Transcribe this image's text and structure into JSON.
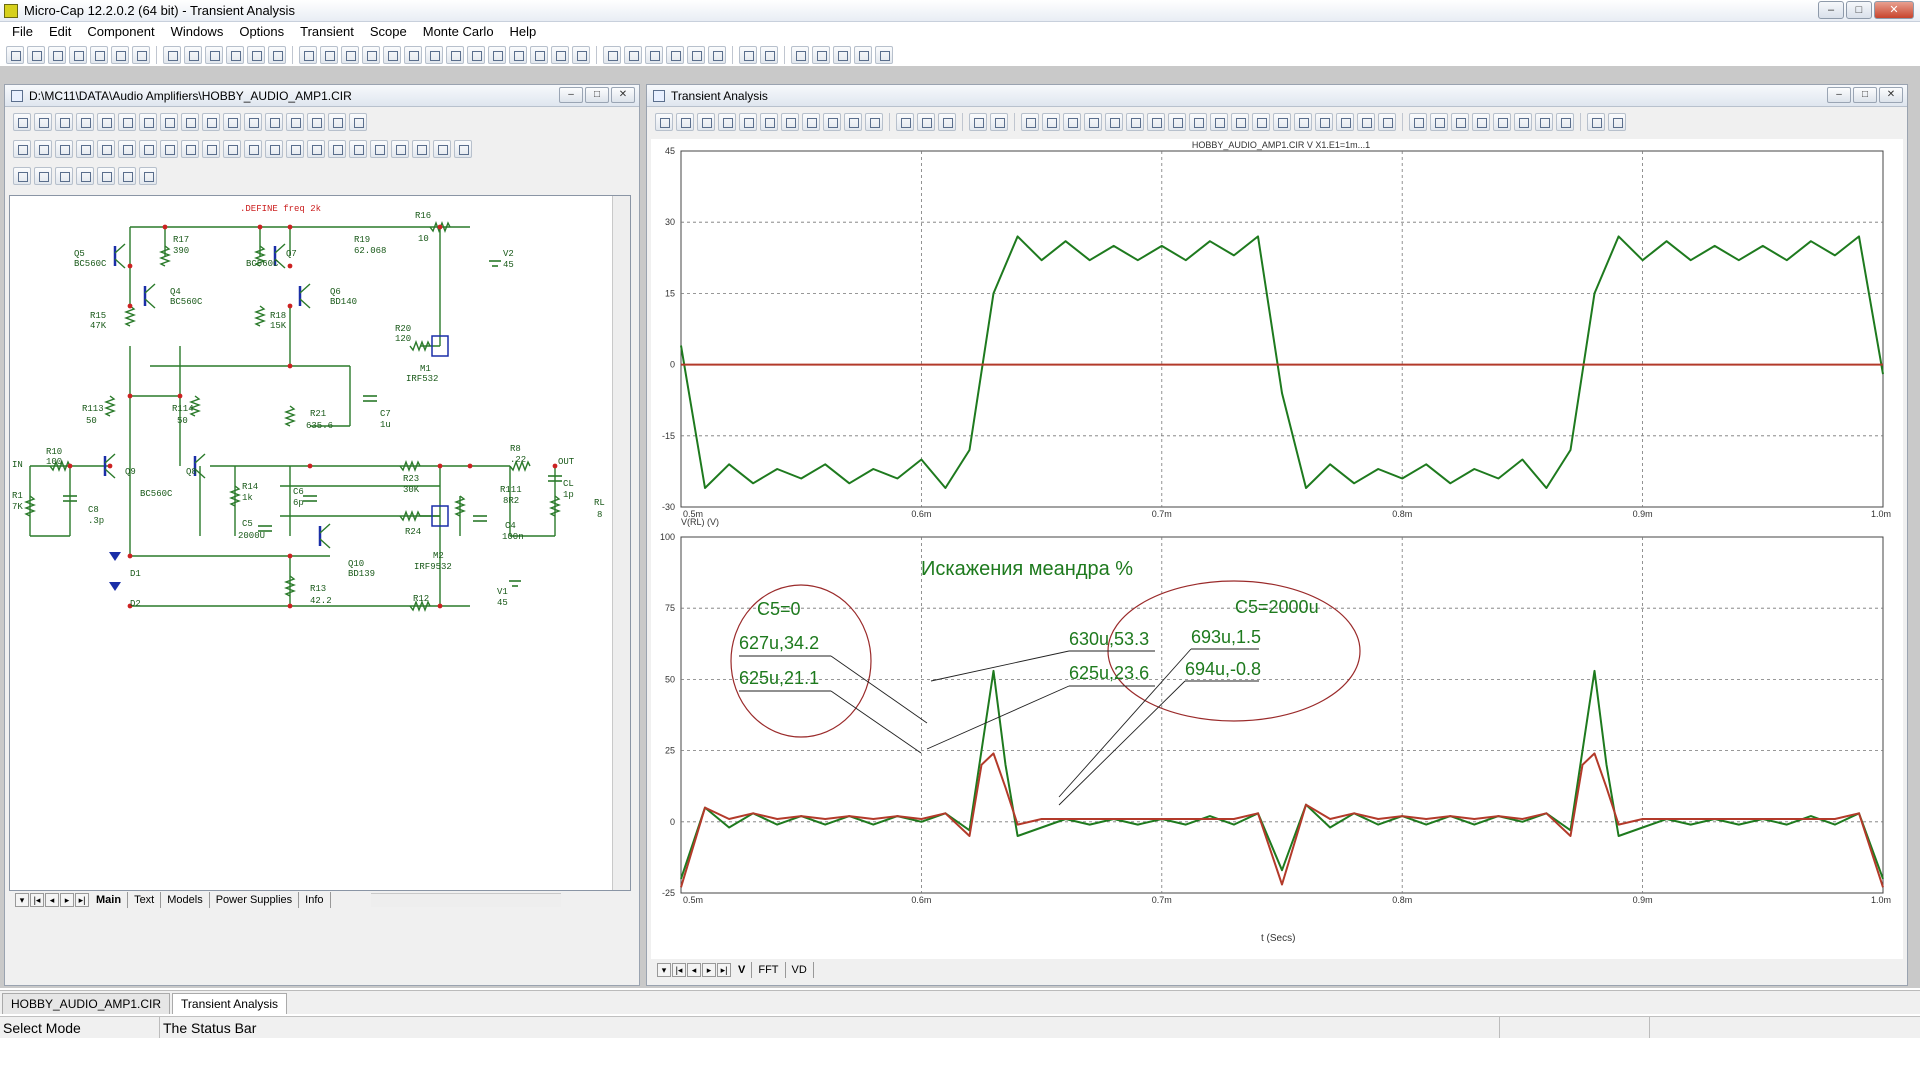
{
  "app": {
    "title": "Micro-Cap 12.2.0.2 (64 bit) - Transient Analysis",
    "window_controls": [
      "–",
      "□",
      "✕"
    ]
  },
  "menu": [
    "File",
    "Edit",
    "Component",
    "Windows",
    "Options",
    "Transient",
    "Scope",
    "Monte Carlo",
    "Help"
  ],
  "schematic_window": {
    "title": "D:\\MC11\\DATA\\Audio Amplifiers\\HOBBY_AUDIO_AMP1.CIR",
    "define_text": ".DEFINE freq 2k",
    "tabs": [
      "Main",
      "Text",
      "Models",
      "Power Supplies",
      "Info"
    ],
    "active_tab": "Main",
    "labels": [
      {
        "id": "q5",
        "text": "Q5"
      },
      {
        "id": "q5m",
        "text": "BC560C"
      },
      {
        "id": "r17",
        "text": "R17"
      },
      {
        "id": "r17v",
        "text": "390"
      },
      {
        "id": "q4",
        "text": "Q4"
      },
      {
        "id": "q4m",
        "text": "BC560C"
      },
      {
        "id": "r15",
        "text": "R15"
      },
      {
        "id": "r15v",
        "text": "47K"
      },
      {
        "id": "q7",
        "text": "Q7"
      },
      {
        "id": "q7m",
        "text": "BC560C"
      },
      {
        "id": "r19",
        "text": "R19"
      },
      {
        "id": "r19v",
        "text": "62.068"
      },
      {
        "id": "q6",
        "text": "Q6"
      },
      {
        "id": "q6m",
        "text": "BD140"
      },
      {
        "id": "r18",
        "text": "R18"
      },
      {
        "id": "r18v",
        "text": "15K"
      },
      {
        "id": "r16",
        "text": "R16"
      },
      {
        "id": "r16v",
        "text": "10"
      },
      {
        "id": "v2",
        "text": "V2"
      },
      {
        "id": "v2v",
        "text": "45"
      },
      {
        "id": "r20",
        "text": "R20"
      },
      {
        "id": "r20v",
        "text": "120"
      },
      {
        "id": "m1",
        "text": "M1"
      },
      {
        "id": "m1m",
        "text": "IRF532"
      },
      {
        "id": "r113",
        "text": "R113"
      },
      {
        "id": "r113v",
        "text": "50"
      },
      {
        "id": "r114",
        "text": "R114"
      },
      {
        "id": "r114v",
        "text": "50"
      },
      {
        "id": "r21",
        "text": "R21"
      },
      {
        "id": "r21v",
        "text": "635.6"
      },
      {
        "id": "c7",
        "text": "C7"
      },
      {
        "id": "c7v",
        "text": "1u"
      },
      {
        "id": "r10",
        "text": "R10"
      },
      {
        "id": "r10v",
        "text": "100"
      },
      {
        "id": "in",
        "text": "IN"
      },
      {
        "id": "q9",
        "text": "Q9"
      },
      {
        "id": "q9m",
        "text": "BC560C"
      },
      {
        "id": "q8",
        "text": "Q8"
      },
      {
        "id": "r1",
        "text": "R1"
      },
      {
        "id": "r1v",
        "text": "7K"
      },
      {
        "id": "c8",
        "text": "C8"
      },
      {
        "id": "c8v",
        "text": ".3p"
      },
      {
        "id": "r14",
        "text": "R14"
      },
      {
        "id": "r14v",
        "text": "1k"
      },
      {
        "id": "c5",
        "text": "C5"
      },
      {
        "id": "c5v",
        "text": "2000U"
      },
      {
        "id": "c6",
        "text": "C6"
      },
      {
        "id": "c6v",
        "text": "6p"
      },
      {
        "id": "r23",
        "text": "R23"
      },
      {
        "id": "r23v",
        "text": "30K"
      },
      {
        "id": "r8",
        "text": "R8"
      },
      {
        "id": "r8v",
        "text": ".22"
      },
      {
        "id": "out",
        "text": "OUT"
      },
      {
        "id": "r111",
        "text": "R111"
      },
      {
        "id": "r111v",
        "text": "8R2"
      },
      {
        "id": "cl",
        "text": "CL"
      },
      {
        "id": "clv",
        "text": "1p"
      },
      {
        "id": "rl",
        "text": "RL"
      },
      {
        "id": "rlv",
        "text": "8"
      },
      {
        "id": "r24",
        "text": "R24"
      },
      {
        "id": "c4",
        "text": "C4"
      },
      {
        "id": "c4v",
        "text": "100n"
      },
      {
        "id": "q10",
        "text": "Q10"
      },
      {
        "id": "q10m",
        "text": "BD139"
      },
      {
        "id": "m2",
        "text": "M2"
      },
      {
        "id": "m2m",
        "text": "IRF9532"
      },
      {
        "id": "d1",
        "text": "D1"
      },
      {
        "id": "d2",
        "text": "D2"
      },
      {
        "id": "r13",
        "text": "R13"
      },
      {
        "id": "r13v",
        "text": "42.2"
      },
      {
        "id": "r12",
        "text": "R12"
      },
      {
        "id": "v1",
        "text": "V1"
      },
      {
        "id": "v1v",
        "text": "45"
      }
    ]
  },
  "analysis_window": {
    "title": "Transient Analysis",
    "tabs": [
      "V",
      "FFT",
      "VD"
    ],
    "active_tab": "V",
    "x_axis_label": "t (Secs)"
  },
  "chart_data": [
    {
      "type": "line",
      "title": "HOBBY_AUDIO_AMP1.CIR V X1.E1=1m...1",
      "ylabel": "V(RL) (V)",
      "xlabel": "",
      "x_range": [
        0.5,
        1.0
      ],
      "x_unit": "m",
      "ylim": [
        -30,
        45
      ],
      "y_ticks": [
        45,
        30,
        15,
        0,
        -15,
        -30
      ],
      "x_ticks": [
        "0.5m",
        "0.6m",
        "0.7m",
        "0.8m",
        "0.9m",
        "1.0m"
      ],
      "grid": true,
      "series": [
        {
          "color": "#1e7a1e",
          "x": [
            0.5,
            0.51,
            0.52,
            0.53,
            0.54,
            0.55,
            0.56,
            0.57,
            0.58,
            0.59,
            0.6,
            0.61,
            0.62,
            0.63,
            0.64,
            0.65,
            0.66,
            0.67,
            0.68,
            0.69,
            0.7,
            0.71,
            0.72,
            0.73,
            0.74,
            0.75,
            0.76,
            0.77,
            0.78,
            0.79,
            0.8,
            0.81,
            0.82,
            0.83,
            0.84,
            0.85,
            0.86,
            0.87,
            0.88,
            0.89,
            0.9,
            0.91,
            0.92,
            0.93,
            0.94,
            0.95,
            0.96,
            0.97,
            0.98,
            0.99,
            1.0
          ],
          "y": [
            4,
            -26,
            -21,
            -25,
            -22,
            -24,
            -21,
            -25,
            -22,
            -24,
            -20,
            -26,
            -18,
            15,
            27,
            22,
            26,
            22,
            25,
            22,
            25,
            22,
            26,
            23,
            27,
            -6,
            -26,
            -21,
            -25,
            -22,
            -24,
            -21,
            -25,
            -22,
            -24,
            -20,
            -26,
            -18,
            15,
            27,
            22,
            26,
            22,
            25,
            22,
            25,
            22,
            26,
            23,
            27,
            -2
          ]
        },
        {
          "color": "#b33a2a",
          "x": [
            0.5,
            1.0
          ],
          "y": [
            0,
            0
          ]
        }
      ]
    },
    {
      "type": "line",
      "title": "Искажения меандра %",
      "xlabel": "t (Secs)",
      "ylabel": "",
      "x_range": [
        0.5,
        1.0
      ],
      "ylim": [
        -25,
        100
      ],
      "y_ticks": [
        100,
        75,
        50,
        25,
        0,
        -25
      ],
      "x_ticks": [
        "0.5m",
        "0.6m",
        "0.7m",
        "0.8m",
        "0.9m",
        "1.0m"
      ],
      "grid": true,
      "annotations": [
        {
          "group": "C5=0",
          "labels": [
            "627u,34.2",
            "625u,21.1"
          ]
        },
        {
          "group": "C5=2000u",
          "labels": [
            "630u,53.3",
            "625u,23.6",
            "693u,1.5",
            "694u,-0.8"
          ]
        }
      ],
      "series": [
        {
          "color": "#1e7a1e",
          "x": [
            0.5,
            0.51,
            0.52,
            0.53,
            0.54,
            0.55,
            0.56,
            0.57,
            0.58,
            0.59,
            0.6,
            0.61,
            0.62,
            0.625,
            0.63,
            0.635,
            0.64,
            0.65,
            0.66,
            0.67,
            0.68,
            0.69,
            0.7,
            0.71,
            0.72,
            0.73,
            0.74,
            0.75,
            0.76,
            0.77,
            0.78,
            0.79,
            0.8,
            0.81,
            0.82,
            0.83,
            0.84,
            0.85,
            0.86,
            0.87,
            0.875,
            0.88,
            0.885,
            0.89,
            0.9,
            0.91,
            0.92,
            0.93,
            0.94,
            0.95,
            0.96,
            0.97,
            0.98,
            0.99,
            1.0
          ],
          "y": [
            -20,
            5,
            -2,
            3,
            -1,
            2,
            -1,
            2,
            -1,
            2,
            0,
            3,
            -3,
            25,
            53,
            20,
            -5,
            -2,
            1,
            -1,
            1,
            -1,
            1,
            -1,
            2,
            -1,
            3,
            -17,
            6,
            -2,
            3,
            -1,
            2,
            -1,
            2,
            -1,
            2,
            0,
            3,
            -3,
            25,
            53,
            20,
            -5,
            -2,
            1,
            -1,
            1,
            -1,
            1,
            -1,
            2,
            -1,
            3,
            -20
          ]
        },
        {
          "color": "#b33a2a",
          "x": [
            0.5,
            0.51,
            0.52,
            0.53,
            0.54,
            0.55,
            0.56,
            0.57,
            0.58,
            0.59,
            0.6,
            0.61,
            0.62,
            0.625,
            0.63,
            0.635,
            0.64,
            0.65,
            0.66,
            0.67,
            0.68,
            0.69,
            0.7,
            0.71,
            0.72,
            0.73,
            0.74,
            0.75,
            0.76,
            0.77,
            0.78,
            0.79,
            0.8,
            0.81,
            0.82,
            0.83,
            0.84,
            0.85,
            0.86,
            0.87,
            0.875,
            0.88,
            0.885,
            0.89,
            0.9,
            0.91,
            0.92,
            0.93,
            0.94,
            0.95,
            0.96,
            0.97,
            0.98,
            0.99,
            1.0
          ],
          "y": [
            -23,
            5,
            1,
            3,
            1,
            2,
            1,
            2,
            1,
            2,
            1,
            3,
            -5,
            20,
            24,
            12,
            -1,
            1,
            1,
            1,
            1,
            1,
            1,
            1,
            1,
            1,
            3,
            -22,
            6,
            1,
            3,
            1,
            2,
            1,
            2,
            1,
            2,
            1,
            3,
            -5,
            20,
            24,
            12,
            -1,
            1,
            1,
            1,
            1,
            1,
            1,
            1,
            1,
            1,
            3,
            -23
          ]
        }
      ]
    }
  ],
  "taskbar": {
    "tabs": [
      "HOBBY_AUDIO_AMP1.CIR",
      "Transient Analysis"
    ],
    "active": "Transient Analysis"
  },
  "status": {
    "mode": "Select Mode",
    "message": "The Status Bar"
  },
  "colors": {
    "green_trace": "#1e7a1e",
    "red_trace": "#b33a2a",
    "schematic_wire": "#2a7a2a",
    "schematic_node": "#cc2222",
    "annotation_ellipse": "#9a2a2a"
  }
}
